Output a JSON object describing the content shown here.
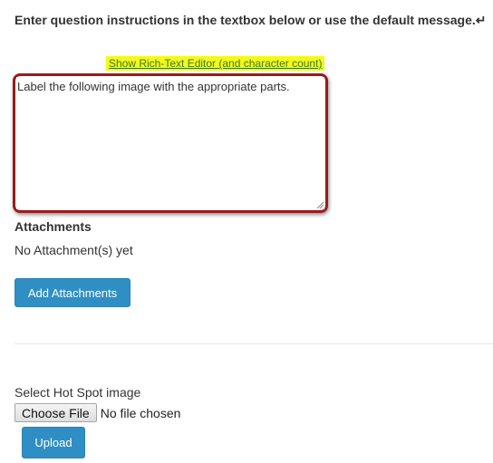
{
  "instructions": "Enter question instructions in the textbox below or use the default message.↵",
  "rich_text_link": "Show Rich-Text Editor (and character count)",
  "question_text": "Label the following image with the appropriate parts.",
  "attachments": {
    "title": "Attachments",
    "empty_text": "No Attachment(s) yet",
    "add_button": "Add Attachments"
  },
  "hotspot": {
    "label": "Select Hot Spot image",
    "choose_file_button": "Choose File",
    "file_status": "No file chosen",
    "upload_button": "Upload"
  },
  "colors": {
    "button_blue": "#2f8fc4",
    "highlight_yellow": "#f4f91a",
    "callout_red": "#9b1b1b"
  }
}
